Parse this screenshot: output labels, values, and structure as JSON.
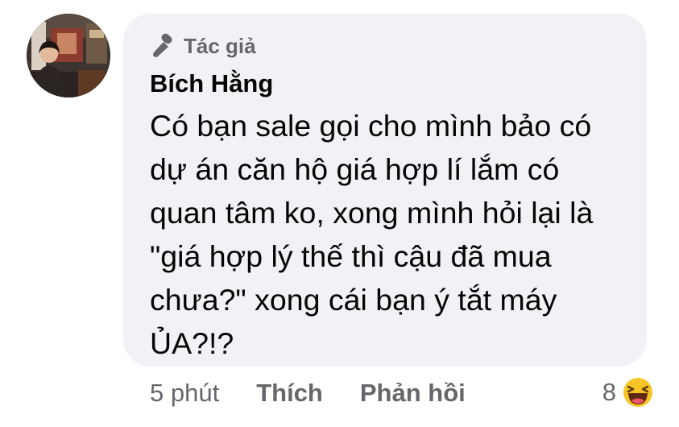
{
  "comment": {
    "badge": {
      "icon": "microphone-icon",
      "label": "Tác giả"
    },
    "author": "Bích Hằng",
    "text": "Có bạn sale gọi cho mình bảo có\ndự án căn hộ giá hợp lí lắm có\nquan tâm ko, xong mình hỏi lại là\n\"giá hợp lý thế thì cậu đã mua\nchưa?\" xong cái bạn ý tắt máy\nỦA?!?",
    "bubble_color": "#f0f2f5"
  },
  "actions": {
    "time": "5 phút",
    "like_label": "Thích",
    "reply_label": "Phản hồi"
  },
  "reactions": {
    "count": "8",
    "icon": "haha-emoji-icon"
  },
  "colors": {
    "text_primary": "#050505",
    "text_secondary": "#65676b"
  }
}
